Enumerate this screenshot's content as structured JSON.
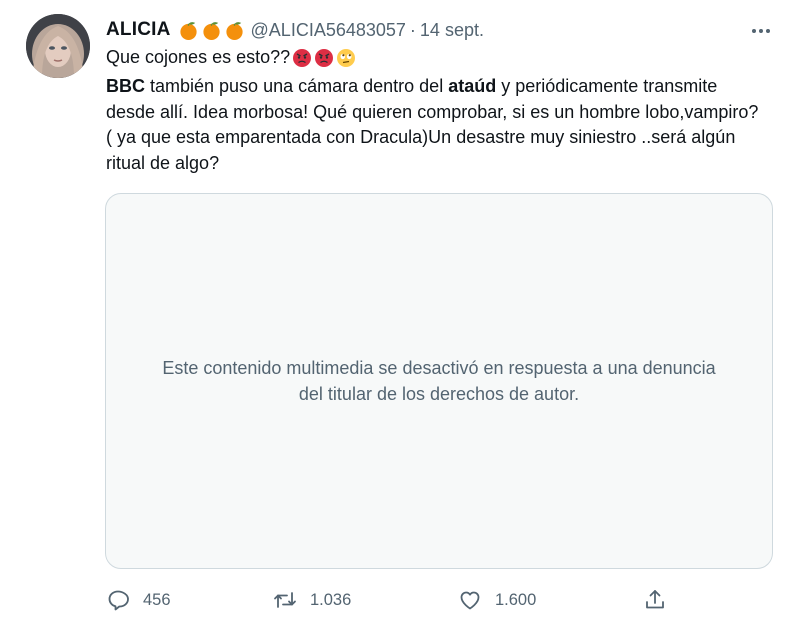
{
  "tweet": {
    "author_name": "ALICIA",
    "handle": "@ALICIA56483057",
    "separator": "·",
    "date": "14 sept.",
    "line1": "Que  cojones es esto??",
    "body": {
      "brand": "BBC",
      "part1": " también puso una cámara dentro del ",
      "keyword": "ataúd",
      "part2": " y periódicamente transmite desde allí. Idea morbosa! Qué quieren comprobar, si es un hombre lobo,vampiro? ( ya que esta emparentada con Dracula)Un desastre muy siniestro ..será algún ritual de algo?"
    },
    "media_notice": "Este contenido multimedia se desactivó en respuesta a una denuncia del titular de los derechos de autor.",
    "actions": {
      "replies": "456",
      "retweets": "1.036",
      "likes": "1.600"
    }
  },
  "icons": {
    "name_emojis": [
      "orange-emoji",
      "orange-emoji",
      "orange-emoji"
    ],
    "text_emojis": [
      "angry-face-emoji",
      "angry-face-emoji",
      "eye-roll-emoji"
    ],
    "more": "more-dots-icon",
    "reply": "reply-icon",
    "retweet": "retweet-icon",
    "like": "heart-icon",
    "share": "share-icon"
  },
  "colors": {
    "text": "#0f1419",
    "secondary": "#536471",
    "border": "#cfd9de",
    "media_bg": "#f7f9f9",
    "orange": "#f4900c",
    "angry_red": "#dd2e44"
  }
}
